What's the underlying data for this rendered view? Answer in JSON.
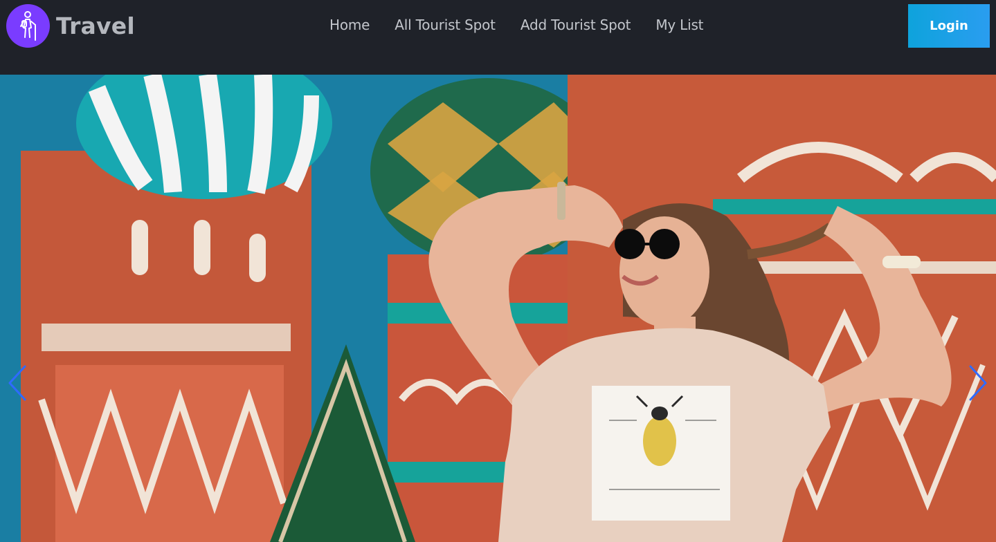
{
  "header": {
    "brand_name": "Travel",
    "logo_icon": "hiker-icon",
    "nav": [
      {
        "label": "Home"
      },
      {
        "label": "All Tourist Spot"
      },
      {
        "label": "Add Tourist Spot"
      },
      {
        "label": "My List"
      }
    ],
    "login_label": "Login"
  },
  "hero": {
    "slider": {
      "prev_icon": "chevron-left-icon",
      "next_icon": "chevron-right-icon"
    }
  },
  "colors": {
    "navbar_bg": "#1f2229",
    "logo_bg": "#7a3cff",
    "login_gradient_start": "#0ea3dc",
    "login_gradient_end": "#2a9df0",
    "arrow_color": "#2f6bff"
  }
}
